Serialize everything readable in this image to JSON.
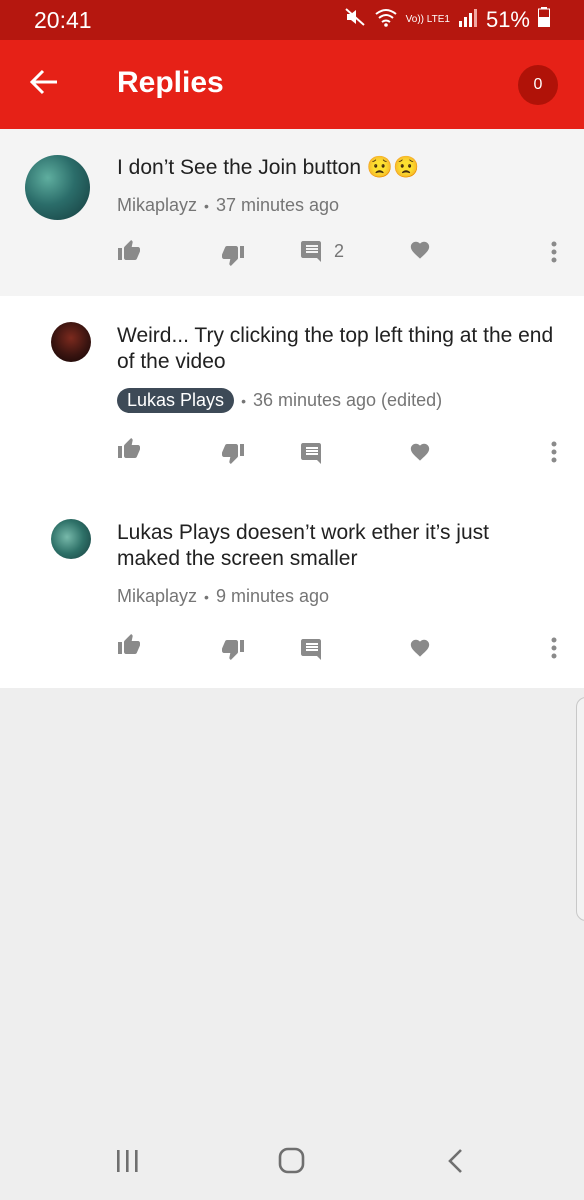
{
  "status_bar": {
    "time": "20:41",
    "battery": "51%",
    "network_label": "Vo)) LTE1"
  },
  "app_bar": {
    "title": "Replies",
    "badge_count": "0"
  },
  "comments": [
    {
      "text": "I don’t See the Join button 😟😟",
      "author": "Mikaplayz",
      "time": "37 minutes ago",
      "reply_count": "2"
    },
    {
      "text": "Weird... Try clicking the top left thing at the end of the video",
      "author": "Lukas Plays",
      "time": "36 minutes ago (edited)"
    },
    {
      "text": "Lukas Plays doesen’t work ether it’s just maked the screen smaller",
      "author": "Mikaplayz",
      "time": "9 minutes ago"
    }
  ],
  "colors": {
    "status_bar": "#b5170f",
    "app_bar": "#e62117",
    "badge": "#b01208",
    "author_chip": "#3d4a57"
  },
  "icons": [
    "back-arrow-icon",
    "mute-icon",
    "wifi-icon",
    "signal-icon",
    "battery-icon",
    "thumb-up-icon",
    "thumb-down-icon",
    "comment-icon",
    "heart-icon",
    "more-vert-icon",
    "recent-apps-icon",
    "home-icon",
    "back-icon"
  ]
}
